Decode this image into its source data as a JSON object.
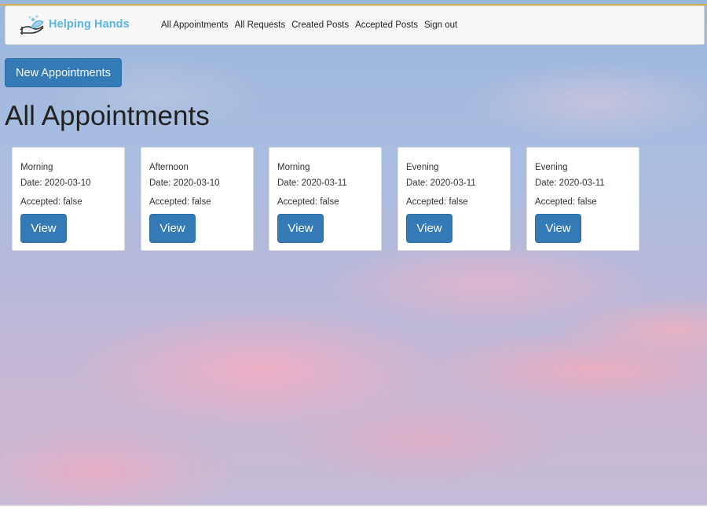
{
  "nav": {
    "brand": "Helping Hands",
    "brand_icon": "helping-hands-logo",
    "links": [
      "All Appointments",
      "All Requests",
      "Created Posts",
      "Accepted Posts",
      "Sign out"
    ]
  },
  "actions": {
    "new_label": "New Appointments"
  },
  "page": {
    "title": "All Appointments"
  },
  "appointments": [
    {
      "time": "Morning",
      "date": "Date: 2020-03-10",
      "accepted": "Accepted: false",
      "view": "View"
    },
    {
      "time": "Afternoon",
      "date": "Date: 2020-03-10",
      "accepted": "Accepted: false",
      "view": "View"
    },
    {
      "time": "Morning",
      "date": "Date: 2020-03-11",
      "accepted": "Accepted: false",
      "view": "View"
    },
    {
      "time": "Evening",
      "date": "Date: 2020-03-11",
      "accepted": "Accepted: false",
      "view": "View"
    },
    {
      "time": "Evening",
      "date": "Date: 2020-03-11",
      "accepted": "Accepted: false",
      "view": "View"
    }
  ],
  "colors": {
    "accent": "#337ab7",
    "brand": "#5ab4e4"
  }
}
